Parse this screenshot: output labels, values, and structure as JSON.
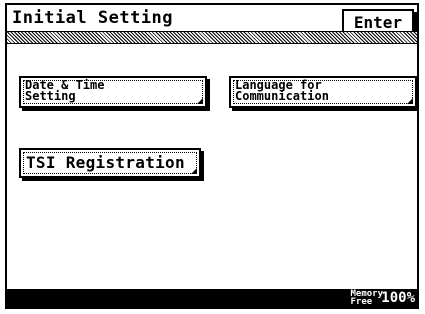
{
  "header": {
    "title": "Initial Setting",
    "enter_label": "Enter"
  },
  "buttons": {
    "date_time": "Date & Time\nSetting",
    "language": "Language for\nCommunication",
    "tsi": "TSI Registration"
  },
  "status": {
    "memory_label": "Memory\nFree",
    "memory_value": "100%"
  }
}
